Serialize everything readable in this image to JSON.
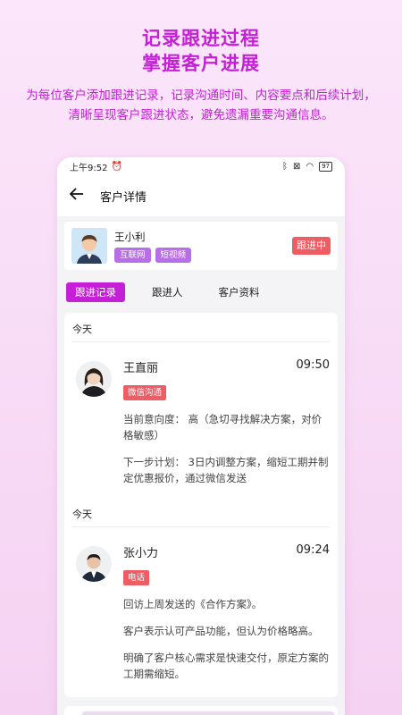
{
  "promo": {
    "title_line1": "记录跟进过程",
    "title_line2": "掌握客户进展",
    "description": "为每位客户添加跟进记录，记录沟通时间、内容要点和后续计划，清晰呈现客户跟进状态，避免遗漏重要沟通信息。"
  },
  "status_bar": {
    "time": "上午9:52",
    "battery": "97"
  },
  "header": {
    "title": "客户详情"
  },
  "customer": {
    "name": "王小利",
    "tags": [
      "互联网",
      "短视频"
    ],
    "status": "跟进中"
  },
  "tabs": [
    "跟进记录",
    "跟进人",
    "客户资料"
  ],
  "records": [
    {
      "day": "今天",
      "name": "王直丽",
      "time": "09:50",
      "method": "微信沟通",
      "lines": [
        "当前意向度：  高（急切寻找解决方案，对价格敏感）",
        "下一步计划：  3日内调整方案，缩短工期并制定优惠报价，通过微信发送"
      ]
    },
    {
      "day": "今天",
      "name": "张小力",
      "time": "09:24",
      "method": "电话",
      "lines": [
        "回访上周发送的《合作方案》。",
        "客户表示认可产品功能，但认为价格略高。",
        "明确了客户核心需求是快速交付，原定方案的工期需缩短。"
      ]
    }
  ],
  "colors": {
    "accent": "#c51fd8",
    "status_red": "#ee5c64",
    "tag_purple": "#b86ee6"
  }
}
